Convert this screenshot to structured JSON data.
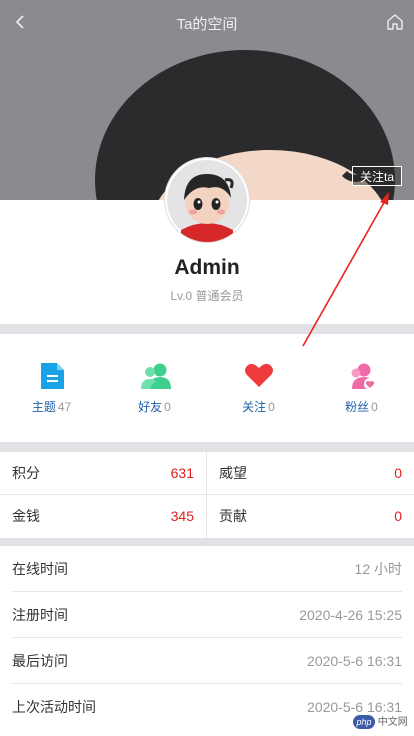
{
  "header": {
    "title": "Ta的空间",
    "back_icon": "chevron-left-icon",
    "home_icon": "home-icon"
  },
  "profile": {
    "follow_label": "关注ta",
    "name": "Admin",
    "level": "Lv.0 普通会员"
  },
  "stats": [
    {
      "label": "主题",
      "count": "47",
      "icon": "document-icon",
      "color": "#1aa2e6"
    },
    {
      "label": "好友",
      "count": "0",
      "icon": "friends-icon",
      "color": "#3ecf8e"
    },
    {
      "label": "关注",
      "count": "0",
      "icon": "heart-icon",
      "color": "#ef3b3b"
    },
    {
      "label": "粉丝",
      "count": "0",
      "icon": "fans-icon",
      "color": "#f06aa6"
    }
  ],
  "points": [
    {
      "label": "积分",
      "value": "631"
    },
    {
      "label": "威望",
      "value": "0"
    },
    {
      "label": "金钱",
      "value": "345"
    },
    {
      "label": "贡献",
      "value": "0"
    }
  ],
  "info": [
    {
      "label": "在线时间",
      "value": "12 小时"
    },
    {
      "label": "注册时间",
      "value": "2020-4-26 15:25"
    },
    {
      "label": "最后访问",
      "value": "2020-5-6 16:31"
    },
    {
      "label": "上次活动时间",
      "value": "2020-5-6 16:31"
    }
  ],
  "watermark": {
    "logo": "php",
    "text": "中文网"
  },
  "colors": {
    "accent_red": "#e02020",
    "arrow": "#e8231f"
  }
}
